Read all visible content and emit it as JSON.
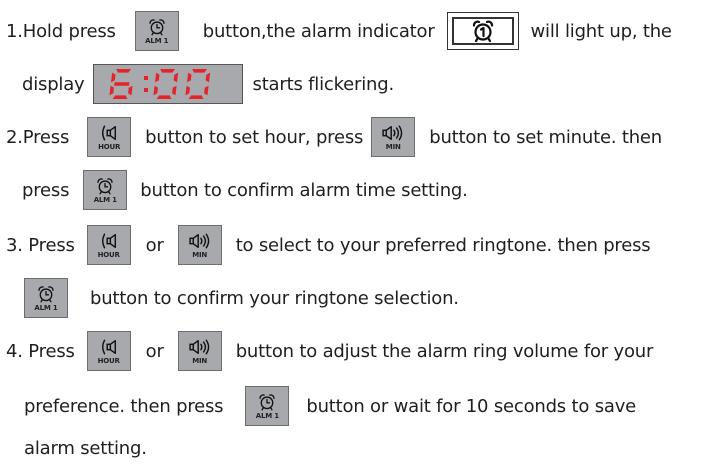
{
  "buttons": {
    "alarm_label": "ALM 1",
    "hour_label": "HOUR",
    "min_label": "MIN"
  },
  "display": {
    "time": "6:00",
    "digit_color": "#e3242b"
  },
  "step1": {
    "part1": "1.Hold press",
    "part2": "button,the alarm indicator",
    "part3": "will light up, the",
    "part4": "display",
    "part5": "starts flickering."
  },
  "step2": {
    "part1": "2.Press",
    "part2": "button to set hour, press",
    "part3": "button to set minute. then",
    "part4": "press",
    "part5": "button to confirm alarm time setting."
  },
  "step3": {
    "part1": "3. Press",
    "part2": "or",
    "part3": "to select to your preferred ringtone. then press",
    "part4": "button to confirm your ringtone selection."
  },
  "step4": {
    "part1": "4. Press",
    "part2": "or",
    "part3": "button to adjust the alarm ring volume for your",
    "part4": "preference. then press",
    "part5": "button or wait for 10 seconds to save",
    "part6": "alarm setting."
  }
}
